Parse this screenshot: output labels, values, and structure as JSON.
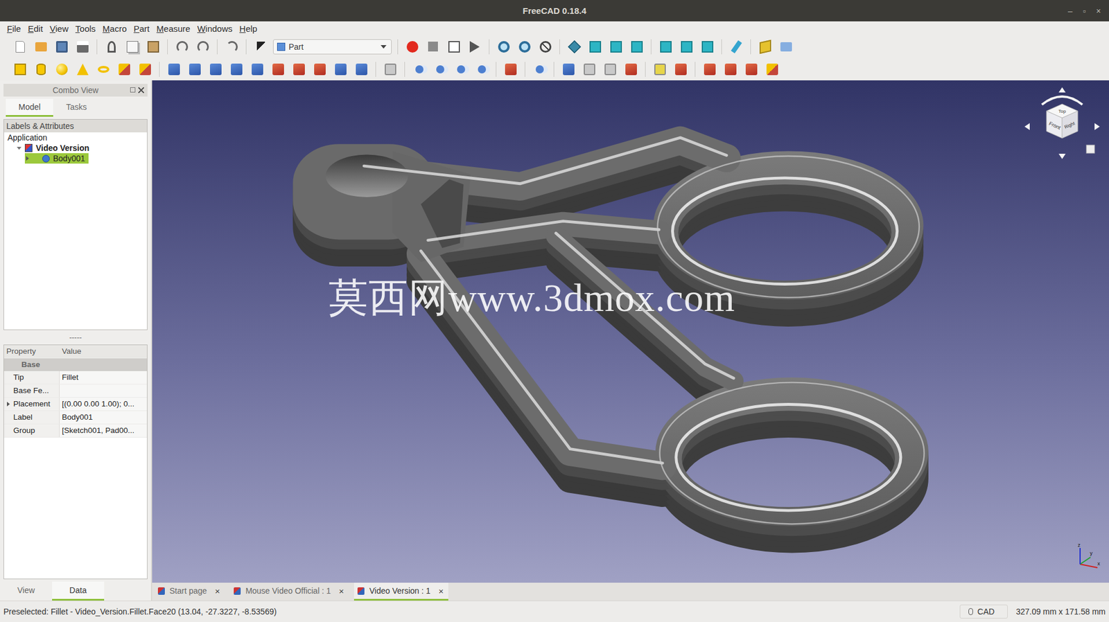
{
  "window": {
    "title": "FreeCAD 0.18.4",
    "controls": [
      "–",
      "▫",
      "×"
    ]
  },
  "menu": [
    "File",
    "Edit",
    "View",
    "Tools",
    "Macro",
    "Part",
    "Measure",
    "Windows",
    "Help"
  ],
  "workbench": {
    "label": "Part"
  },
  "combo_view": {
    "title": "Combo View",
    "tabs": [
      {
        "label": "Model",
        "selected": true
      },
      {
        "label": "Tasks",
        "selected": false
      }
    ]
  },
  "tree": {
    "header": "Labels & Attributes",
    "items": [
      {
        "label": "Application",
        "depth": 0,
        "kind": "root",
        "expanded": true,
        "active": false,
        "selected": false
      },
      {
        "label": "Video Version",
        "depth": 1,
        "kind": "document",
        "expanded": true,
        "active": true,
        "selected": false
      },
      {
        "label": "Body001",
        "depth": 2,
        "kind": "body",
        "expanded": false,
        "active": false,
        "selected": true
      }
    ]
  },
  "splitter": "-----",
  "properties": {
    "columns": [
      "Property",
      "Value"
    ],
    "group": "Base",
    "rows": [
      {
        "name": "Tip",
        "value": "Fillet",
        "expandable": false
      },
      {
        "name": "Base Fe...",
        "value": "",
        "expandable": false
      },
      {
        "name": "Placement",
        "value": "[(0.00 0.00 1.00); 0...",
        "expandable": true
      },
      {
        "name": "Label",
        "value": "Body001",
        "expandable": false
      },
      {
        "name": "Group",
        "value": "[Sketch001, Pad00...",
        "expandable": false
      }
    ]
  },
  "panel_tabs": [
    {
      "label": "View",
      "selected": false
    },
    {
      "label": "Data",
      "selected": true
    }
  ],
  "viewport": {
    "watermark": "莫西网www.3dmox.com",
    "navcube": {
      "front": "Front",
      "top": "Top",
      "right": "Right"
    },
    "axes": {
      "x": "x",
      "y": "y",
      "z": "z"
    }
  },
  "doc_tabs": [
    {
      "label": "Start page",
      "close": "×",
      "selected": false
    },
    {
      "label": "Mouse Video Official : 1",
      "close": "×",
      "selected": false
    },
    {
      "label": "Video Version : 1",
      "close": "×",
      "selected": true
    }
  ],
  "status_bar": {
    "message": "Preselected: Fillet - Video_Version.Fillet.Face20 (13.04, -27.3227, -8.53569)",
    "mode": "CAD",
    "dimensions": "327.09 mm x 171.58 mm"
  }
}
